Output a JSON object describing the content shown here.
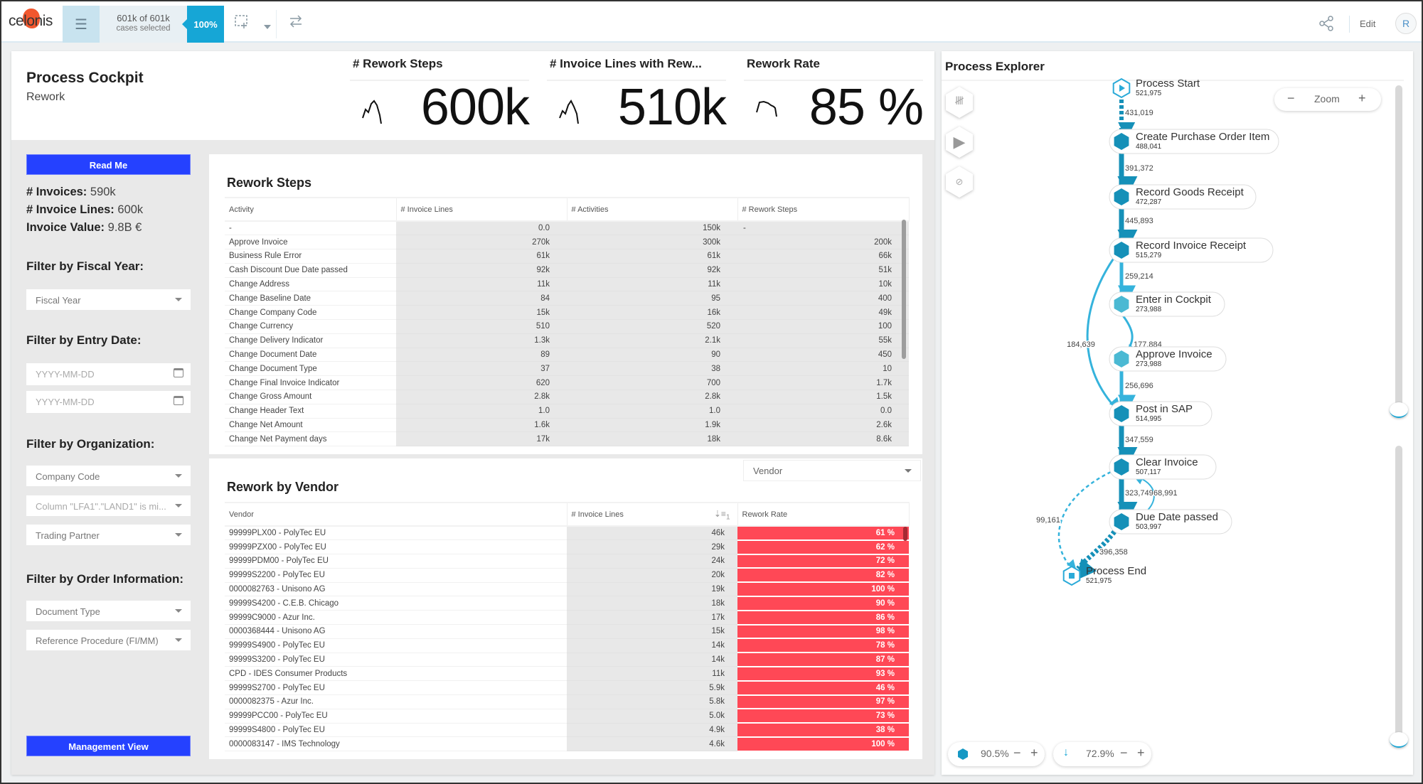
{
  "topbar": {
    "logo": "celonis",
    "cases_selected": "601k of 601k",
    "cases_selected_sub": "cases selected",
    "selection_pct": "100%",
    "edit_label": "Edit",
    "avatar_initial": "R"
  },
  "header": {
    "title": "Process Cockpit",
    "subtitle": "Rework",
    "kpis": [
      {
        "label": "# Rework Steps",
        "value": "600k"
      },
      {
        "label": "# Invoice Lines with Rew...",
        "value": "510k"
      },
      {
        "label": "Rework Rate",
        "value": "85 %"
      }
    ]
  },
  "left_panel": {
    "read_me": "Read Me",
    "stats": [
      {
        "label": "# Invoices:",
        "value": "590k"
      },
      {
        "label": "# Invoice Lines:",
        "value": "600k"
      },
      {
        "label": "Invoice Value:",
        "value": "9.8B €"
      }
    ],
    "fiscal_year_heading": "Filter by Fiscal Year:",
    "fiscal_year_dd": "Fiscal Year",
    "entry_date_heading": "Filter by Entry Date:",
    "date_placeholder_from": "YYYY-MM-DD",
    "date_placeholder_to": "YYYY-MM-DD",
    "org_heading": "Filter by Organization:",
    "company_code_dd": "Company Code",
    "country_dd": "Column \"LFA1\".\"LAND1\" is mi...",
    "trading_partner_dd": "Trading Partner",
    "order_heading": "Filter by Order Information:",
    "document_type_dd": "Document Type",
    "reference_procedure_dd": "Reference Procedure (FI/MM)",
    "management_view": "Management View"
  },
  "rework_steps": {
    "title": "Rework Steps",
    "columns": [
      "Activity",
      "# Invoice Lines",
      "# Activities",
      "# Rework Steps"
    ],
    "rows": [
      [
        "-",
        "0.0",
        "150k",
        "-"
      ],
      [
        "Approve Invoice",
        "270k",
        "300k",
        "200k"
      ],
      [
        "Business Rule Error",
        "61k",
        "61k",
        "66k"
      ],
      [
        "Cash Discount Due Date passed",
        "92k",
        "92k",
        "51k"
      ],
      [
        "Change Address",
        "11k",
        "11k",
        "10k"
      ],
      [
        "Change Baseline Date",
        "84",
        "95",
        "400"
      ],
      [
        "Change Company Code",
        "15k",
        "16k",
        "49k"
      ],
      [
        "Change Currency",
        "510",
        "520",
        "100"
      ],
      [
        "Change Delivery Indicator",
        "1.3k",
        "2.1k",
        "55k"
      ],
      [
        "Change Document Date",
        "89",
        "90",
        "450"
      ],
      [
        "Change Document Type",
        "37",
        "38",
        "10"
      ],
      [
        "Change Final Invoice Indicator",
        "620",
        "700",
        "1.7k"
      ],
      [
        "Change Gross Amount",
        "2.8k",
        "2.8k",
        "1.5k"
      ],
      [
        "Change Header Text",
        "1.0",
        "1.0",
        "0.0"
      ],
      [
        "Change Net Amount",
        "1.6k",
        "1.9k",
        "2.6k"
      ],
      [
        "Change Net Payment days",
        "17k",
        "18k",
        "8.6k"
      ]
    ]
  },
  "rework_by_vendor": {
    "title": "Rework by Vendor",
    "group_by": "Vendor",
    "columns": [
      "Vendor",
      "# Invoice Lines",
      "Rework Rate"
    ],
    "sort_indicator": "1",
    "rows": [
      [
        "99999PLX00 - PolyTec EU",
        "46k",
        "61 %"
      ],
      [
        "99999PZX00 - PolyTec EU",
        "29k",
        "62 %"
      ],
      [
        "99999PDM00 - PolyTec EU",
        "24k",
        "72 %"
      ],
      [
        "99999S2200 - PolyTec EU",
        "20k",
        "82 %"
      ],
      [
        "0000082763 - Unisono AG",
        "19k",
        "100 %"
      ],
      [
        "99999S4200 - C.E.B. Chicago",
        "18k",
        "90 %"
      ],
      [
        "99999C9000 - Azur Inc.",
        "17k",
        "86 %"
      ],
      [
        "0000368444 - Unisono AG",
        "15k",
        "98 %"
      ],
      [
        "99999S4900 - PolyTec EU",
        "14k",
        "78 %"
      ],
      [
        "99999S3200 - PolyTec EU",
        "14k",
        "87 %"
      ],
      [
        "CPD - IDES Consumer Products",
        "11k",
        "93 %"
      ],
      [
        "99999S2700 - PolyTec EU",
        "5.9k",
        "46 %"
      ],
      [
        "0000082375 - Azur Inc.",
        "5.8k",
        "97 %"
      ],
      [
        "99999PCC00 - PolyTec EU",
        "5.0k",
        "73 %"
      ],
      [
        "99999S4800 - PolyTec EU",
        "4.9k",
        "38 %"
      ],
      [
        "0000083147 - IMS Technology",
        "4.6k",
        "100 %"
      ]
    ]
  },
  "process_explorer": {
    "title": "Process Explorer",
    "zoom_label": "Zoom",
    "activity_coverage": "90.5%",
    "connection_coverage": "72.9%",
    "nodes": [
      {
        "id": "start",
        "label": "Process Start",
        "count": "521,975"
      },
      {
        "id": "cpoi",
        "label": "Create Purchase Order Item",
        "count": "488,041"
      },
      {
        "id": "rgr",
        "label": "Record Goods Receipt",
        "count": "472,287"
      },
      {
        "id": "rir",
        "label": "Record Invoice Receipt",
        "count": "515,279"
      },
      {
        "id": "eic",
        "label": "Enter in Cockpit",
        "count": "273,988"
      },
      {
        "id": "ai",
        "label": "Approve Invoice",
        "count": "273,988"
      },
      {
        "id": "pis",
        "label": "Post in SAP",
        "count": "514,995"
      },
      {
        "id": "ci",
        "label": "Clear Invoice",
        "count": "507,117"
      },
      {
        "id": "ddp",
        "label": "Due Date passed",
        "count": "503,997"
      },
      {
        "id": "end",
        "label": "Process End",
        "count": "521,975"
      }
    ],
    "edges": [
      {
        "from": "start",
        "to": "cpoi",
        "count": "431,019"
      },
      {
        "from": "cpoi",
        "to": "rgr",
        "count": "391,372"
      },
      {
        "from": "rgr",
        "to": "rir",
        "count": "445,893"
      },
      {
        "from": "rir",
        "to": "eic",
        "count": "259,214"
      },
      {
        "from": "rir",
        "to": "pis",
        "count": "184,639"
      },
      {
        "from": "eic",
        "to": "ai",
        "count": "177,884"
      },
      {
        "from": "ai",
        "to": "pis",
        "count": "256,696"
      },
      {
        "from": "pis",
        "to": "ci",
        "count": "347,559"
      },
      {
        "from": "ci",
        "to": "ddp",
        "count": "323,749"
      },
      {
        "from": "ddp",
        "to": "ci",
        "count": "68,991"
      },
      {
        "from": "ci",
        "to": "end",
        "count": "99,161"
      },
      {
        "from": "ddp",
        "to": "end",
        "count": "396,358"
      }
    ]
  },
  "colors": {
    "accent": "#16a6d6",
    "button_blue": "#2541ff",
    "rework_red": "#ff4856",
    "node_dark": "#1590b8",
    "node_light": "#4bb9d3"
  }
}
